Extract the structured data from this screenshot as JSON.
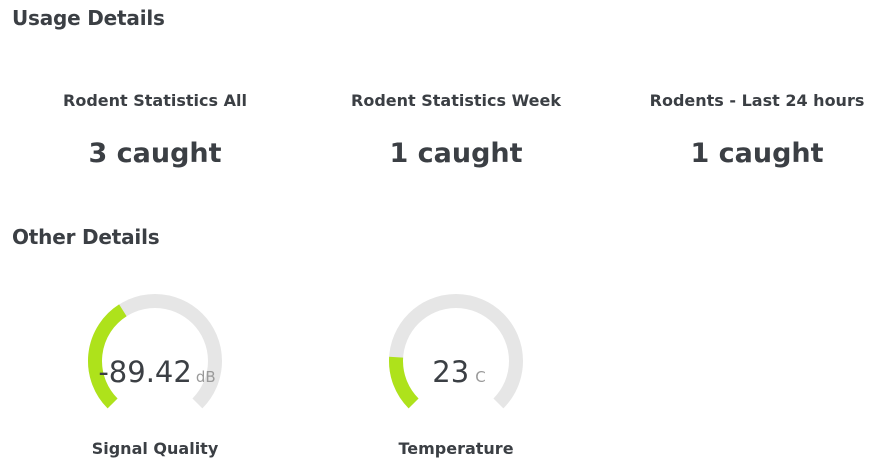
{
  "usage": {
    "title": "Usage Details",
    "stats": [
      {
        "label": "Rodent Statistics All",
        "value": "3 caught"
      },
      {
        "label": "Rodent Statistics Week",
        "value": "1 caught"
      },
      {
        "label": "Rodents - Last 24 hours",
        "value": "1 caught"
      }
    ]
  },
  "other": {
    "title": "Other Details",
    "gauges": [
      {
        "label": "Signal Quality",
        "value": "-89.42",
        "unit": "dB",
        "fill_fraction": 0.38
      },
      {
        "label": "Temperature",
        "value": "23",
        "unit": "C",
        "fill_fraction": 0.18
      }
    ]
  },
  "colors": {
    "gauge_fill": "#aee21b",
    "gauge_track": "#e6e6e6",
    "text": "#3b3f44",
    "unit_text": "#9a9a9a"
  }
}
